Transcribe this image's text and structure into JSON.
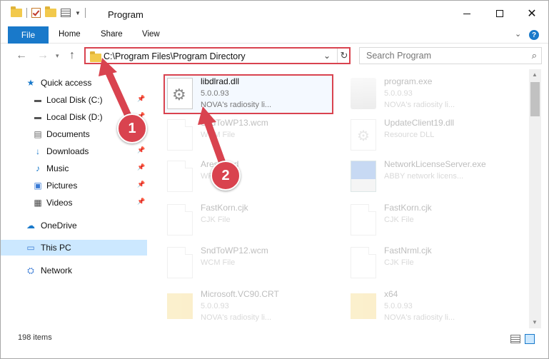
{
  "title": "Program",
  "ribbon": {
    "file": "File",
    "tabs": [
      "Home",
      "Share",
      "View"
    ]
  },
  "address": {
    "path": "C:\\Program Files\\Program Directory",
    "search_placeholder": "Search Program"
  },
  "sidebar": {
    "items": [
      {
        "label": "Quick access",
        "icon": "star-icon"
      },
      {
        "label": "Local Disk (C:)",
        "icon": "drive-icon",
        "pinned": true
      },
      {
        "label": "Local Disk (D:)",
        "icon": "drive-icon",
        "pinned": true
      },
      {
        "label": "Documents",
        "icon": "documents-icon",
        "pinned": true
      },
      {
        "label": "Downloads",
        "icon": "downloads-icon",
        "pinned": true
      },
      {
        "label": "Music",
        "icon": "music-icon",
        "pinned": true
      },
      {
        "label": "Pictures",
        "icon": "pictures-icon",
        "pinned": true
      },
      {
        "label": "Videos",
        "icon": "videos-icon",
        "pinned": true
      },
      {
        "label": "OneDrive",
        "icon": "cloud-icon"
      },
      {
        "label": "This PC",
        "icon": "pc-icon",
        "selected": true
      },
      {
        "label": "Network",
        "icon": "network-icon"
      }
    ]
  },
  "files": [
    {
      "name": "libdlrad.dll",
      "line2": "5.0.0.93",
      "line3": "NOVA's radiosity li...",
      "icon": "gear-file-icon",
      "highlighted": true
    },
    {
      "name": "program.exe",
      "line2": "5.0.0.93",
      "line3": "NOVA's radiosity li...",
      "icon": "exe-icon"
    },
    {
      "name": "SndToWP13.wcm",
      "line2": "WCM File",
      "icon": "file-icon"
    },
    {
      "name": "UpdateClient19.dll",
      "line2": "Resource DLL",
      "icon": "dll-icon"
    },
    {
      "name": "Aresolved",
      "line2": "WPT File",
      "icon": "file-icon"
    },
    {
      "name": "NetworkLicenseServer.exe",
      "line2": "ABBY network licens...",
      "icon": "app-icon"
    },
    {
      "name": "FastKorn.cjk",
      "line2": "CJK File",
      "icon": "file-icon"
    },
    {
      "name": "FastKorn.cjk",
      "line2": "CJK File",
      "icon": "file-icon"
    },
    {
      "name": "SndToWP12.wcm",
      "line2": "WCM File",
      "icon": "file-icon"
    },
    {
      "name": "FastNrml.cjk",
      "line2": "CJK File",
      "icon": "file-icon"
    },
    {
      "name": "Microsoft.VC90.CRT",
      "line2": "5.0.0.93",
      "line3": "NOVA's radiosity li...",
      "icon": "folder-icon"
    },
    {
      "name": "x64",
      "line2": "5.0.0.93",
      "line3": "NOVA's radiosity li...",
      "icon": "folder-icon"
    }
  ],
  "callouts": [
    "1",
    "2"
  ],
  "status": {
    "count": "198 items"
  },
  "colors": {
    "accent": "#1979ca",
    "highlight": "#d9434f",
    "selected": "#cce8ff"
  }
}
